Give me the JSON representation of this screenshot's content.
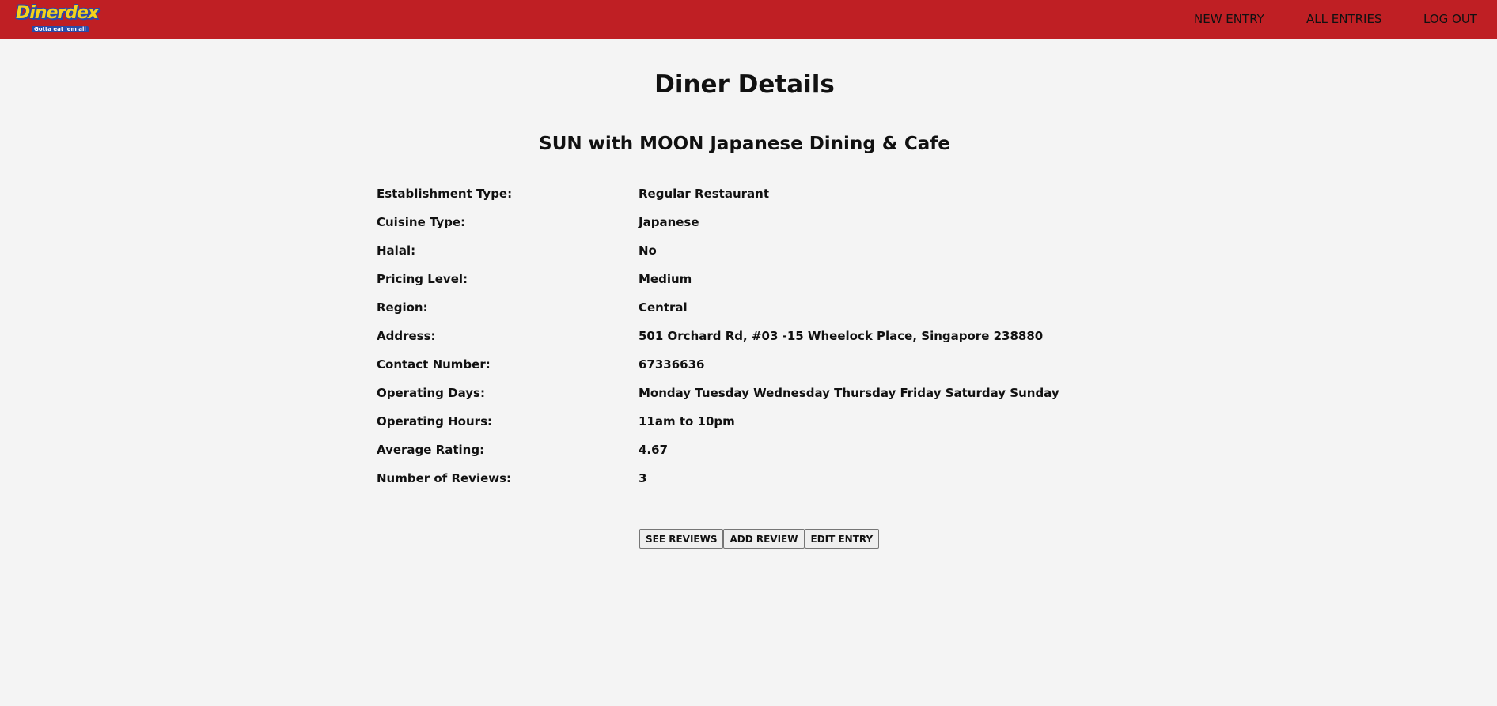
{
  "nav": {
    "logo_text": "Dinerdex",
    "logo_tagline": "Gotta eat 'em all",
    "links": [
      "NEW ENTRY",
      "ALL ENTRIES",
      "LOG OUT"
    ]
  },
  "page": {
    "title": "Diner Details",
    "diner_name": "SUN with MOON Japanese Dining & Cafe"
  },
  "details": [
    {
      "label": "Establishment Type:",
      "value": "Regular Restaurant"
    },
    {
      "label": "Cuisine Type:",
      "value": "Japanese"
    },
    {
      "label": "Halal:",
      "value": "No"
    },
    {
      "label": "Pricing Level:",
      "value": "Medium"
    },
    {
      "label": "Region:",
      "value": "Central"
    },
    {
      "label": "Address:",
      "value": "501 Orchard Rd, #03 -15 Wheelock Place, Singapore 238880"
    },
    {
      "label": "Contact Number:",
      "value": "67336636"
    },
    {
      "label": "Operating Days:",
      "value": "Monday Tuesday Wednesday Thursday Friday Saturday Sunday"
    },
    {
      "label": "Operating Hours:",
      "value": "11am to 10pm"
    },
    {
      "label": "Average Rating:",
      "value": "4.67"
    },
    {
      "label": "Number of Reviews:",
      "value": "3"
    }
  ],
  "actions": {
    "see_reviews": "SEE REVIEWS",
    "add_review": "ADD REVIEW",
    "edit_entry": "EDIT ENTRY"
  },
  "colors": {
    "navbar": "#bf1f24",
    "background": "#f4f4f4",
    "logo_yellow": "#f5d21a",
    "logo_blue": "#2a4aa8"
  }
}
